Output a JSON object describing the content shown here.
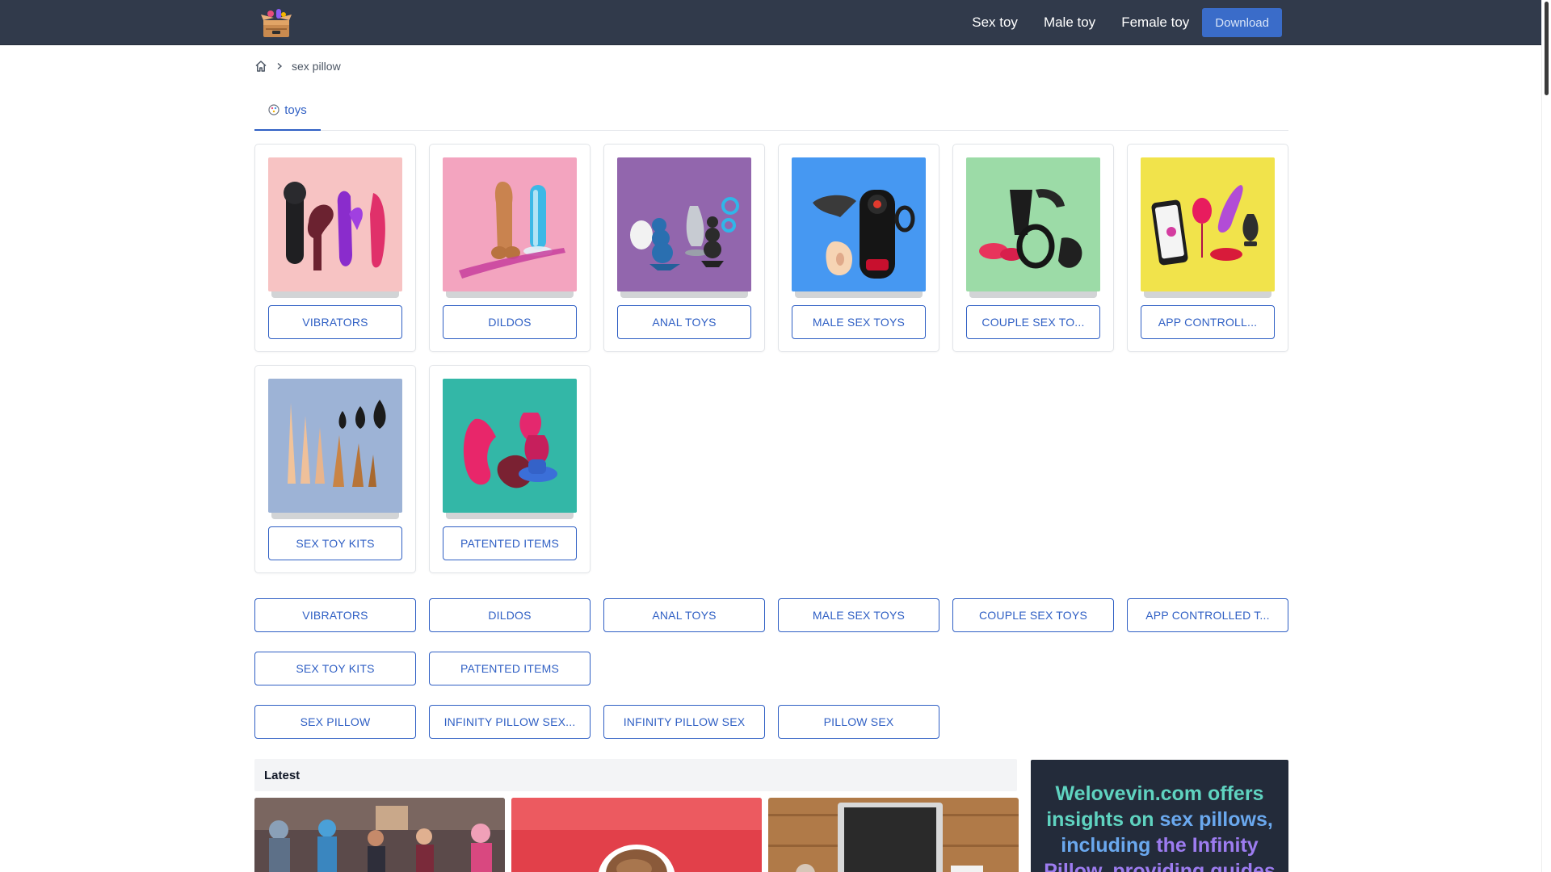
{
  "header": {
    "logo_icon": "toy-box-logo-icon",
    "nav": [
      "Sex toy",
      "Male toy",
      "Female toy"
    ],
    "download_label": "Download"
  },
  "breadcrumb": {
    "home_icon": "home-icon",
    "separator_icon": "chevron-right-icon",
    "current": "sex pillow"
  },
  "tabs": [
    {
      "label": "toys",
      "icon": "toy-box-icon",
      "active": true
    }
  ],
  "categories": [
    {
      "label": "VIBRATORS",
      "bg": "#f7c3c3"
    },
    {
      "label": "DILDOS",
      "bg": "#f3a4bf"
    },
    {
      "label": "ANAL TOYS",
      "bg": "#9266ad"
    },
    {
      "label": "MALE SEX TOYS",
      "bg": "#4698f2"
    },
    {
      "label": "COUPLE SEX TO...",
      "bg": "#9cdba7"
    },
    {
      "label": "APP CONTROLL...",
      "bg": "#f1e34b"
    },
    {
      "label": "SEX TOY KITS",
      "bg": "#9db3d6"
    },
    {
      "label": "PATENTED ITEMS",
      "bg": "#33b7a7"
    }
  ],
  "tag_rows": [
    [
      "VIBRATORS",
      "DILDOS",
      "ANAL TOYS",
      "MALE SEX TOYS",
      "COUPLE SEX TOYS",
      "APP CONTROLLED T..."
    ],
    [
      "SEX TOY KITS",
      "PATENTED ITEMS"
    ],
    [
      "SEX PILLOW",
      "INFINITY PILLOW SEX...",
      "INFINITY PILLOW SEX",
      "PILLOW SEX"
    ]
  ],
  "latest": {
    "title": "Latest"
  },
  "promo": {
    "segments": [
      {
        "text": "Welovevin.com offers insights on ",
        "tone": "p1"
      },
      {
        "text": "sex pillows",
        "tone": "p2"
      },
      {
        "text": ", including ",
        "tone": "p2"
      },
      {
        "text": "the Infinity Pillow, providing guides",
        "tone": "p3"
      }
    ]
  },
  "colors": {
    "header_bg": "#313a4b",
    "accent": "#2f5fc4",
    "download_bg": "#3a6cc9",
    "promo_bg": "#232b3a"
  }
}
